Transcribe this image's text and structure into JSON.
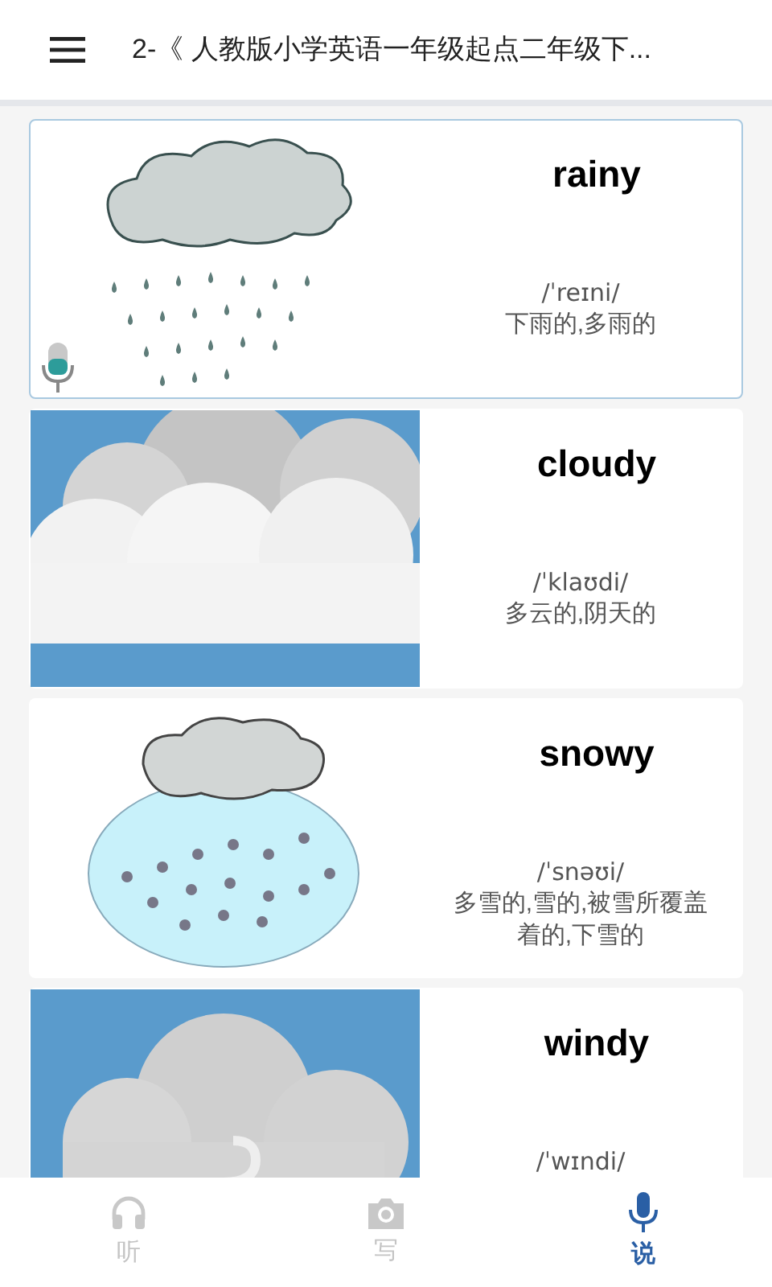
{
  "header": {
    "title": "2-《 人教版小学英语一年级起点二年级下..."
  },
  "words": [
    {
      "word": "rainy",
      "phonetic": "/ˈreɪni/",
      "meaning": "下雨的,多雨的",
      "kind": "rain",
      "selected": true
    },
    {
      "word": "cloudy",
      "phonetic": "/ˈklaʊdi/",
      "meaning": "多云的,阴天的",
      "kind": "cloud",
      "selected": false
    },
    {
      "word": "snowy",
      "phonetic": "/ˈsnəʊi/",
      "meaning": "多雪的,雪的,被雪所覆盖着的,下雪的",
      "kind": "snow",
      "selected": false
    },
    {
      "word": "windy",
      "phonetic": "/ˈwɪndi/",
      "kind": "wind",
      "selected": false
    }
  ],
  "tabs": [
    {
      "label": "听",
      "kind": "listen",
      "selected": false
    },
    {
      "label": "写",
      "kind": "camera",
      "selected": false
    },
    {
      "label": "说",
      "kind": "speak",
      "selected": true
    }
  ]
}
